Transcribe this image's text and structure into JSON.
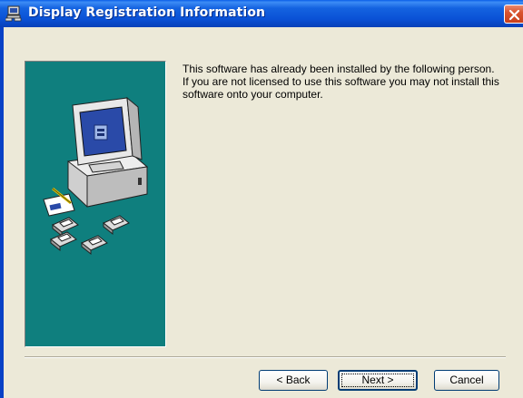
{
  "window": {
    "title": "Display Registration Information"
  },
  "message": {
    "text": "This software has already been installed by the following person. If you are not licensed to use this software you may not install this software onto your computer."
  },
  "buttons": {
    "back": "< Back",
    "next": "Next >",
    "cancel": "Cancel"
  },
  "icons": {
    "title": "setup-computer-icon",
    "close": "close-x-icon",
    "illustration": "computer-with-disks-illustration"
  },
  "colors": {
    "titlebar": "#0a51d6",
    "close": "#d9542f",
    "dialog_bg": "#ece9d8",
    "illustration_bg": "#0f7f7e"
  }
}
